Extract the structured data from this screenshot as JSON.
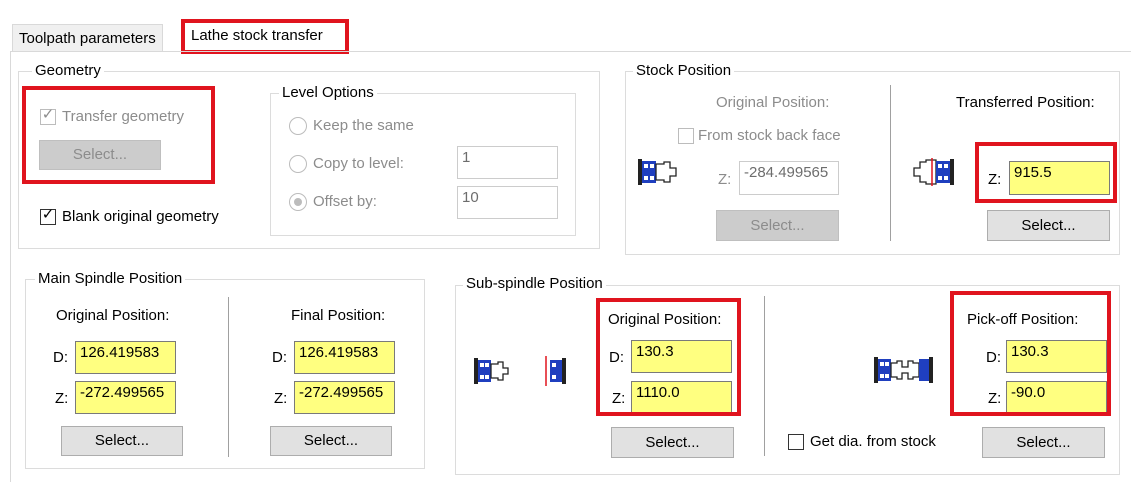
{
  "tabs": [
    {
      "label": "Toolpath parameters"
    },
    {
      "label": "Lathe stock transfer"
    }
  ],
  "geometry": {
    "title": "Geometry",
    "transfer_geometry": "Transfer geometry",
    "select": "Select...",
    "blank_original": "Blank original geometry"
  },
  "level_options": {
    "title": "Level Options",
    "keep_same": "Keep the same",
    "copy_to_level": "Copy to level:",
    "copy_value": "1",
    "offset_by": "Offset by:",
    "offset_value": "10"
  },
  "stock_position": {
    "title": "Stock Position",
    "original_label": "Original Position:",
    "from_back_face": "From stock back face",
    "z_label": "Z:",
    "original_z": "-284.499565",
    "select_original": "Select...",
    "transferred_label": "Transferred Position:",
    "transferred_z": "915.5",
    "select_transferred": "Select..."
  },
  "main_spindle": {
    "title": "Main Spindle Position",
    "original_label": "Original Position:",
    "final_label": "Final Position:",
    "d_label": "D:",
    "z_label": "Z:",
    "original_d": "126.419583",
    "original_z": "-272.499565",
    "final_d": "126.419583",
    "final_z": "-272.499565",
    "select_original": "Select...",
    "select_final": "Select..."
  },
  "sub_spindle": {
    "title": "Sub-spindle Position",
    "original_label": "Original Position:",
    "d_label": "D:",
    "z_label": "Z:",
    "original_d": "130.3",
    "original_z": "1110.0",
    "select_original": "Select...",
    "get_dia": "Get dia. from stock",
    "pickoff_label": "Pick-off  Position:",
    "pickoff_d": "130.3",
    "pickoff_z": "-90.0",
    "select_pickoff": "Select..."
  },
  "colors": {
    "highlight": "#e0141e",
    "field_bg": "#ffff80",
    "spindle_blue": "#1f3fbf"
  }
}
